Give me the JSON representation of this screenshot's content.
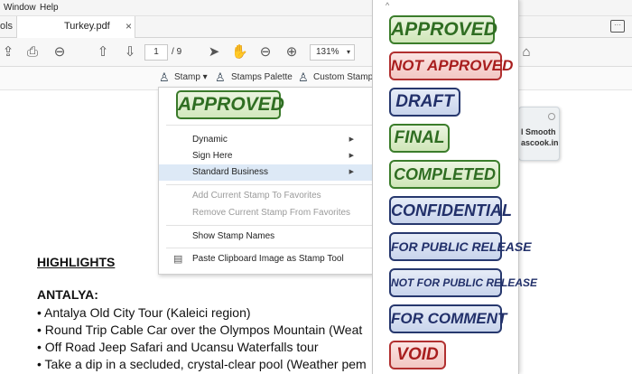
{
  "menubar": {
    "window": "Window",
    "help": "Help"
  },
  "tabs": {
    "tools": "ols",
    "document": "Turkey.pdf",
    "close": "×"
  },
  "toolbar": {
    "page_current": "1",
    "page_separator": "/",
    "page_total": "9",
    "zoom": "131%",
    "icons": [
      "upload-icon",
      "print-icon",
      "zoom-out-search-icon",
      "prev-page-icon",
      "next-page-icon",
      "select-arrow-icon",
      "hand-icon",
      "zoom-out-icon",
      "zoom-in-icon"
    ]
  },
  "stampbar": {
    "stamp": "Stamp",
    "palette": "Stamps Palette",
    "custom": "Custom Stamps"
  },
  "stamp_menu": {
    "preview": "APPROVED",
    "items": {
      "dynamic": "Dynamic",
      "sign_here": "Sign Here",
      "standard_business": "Standard Business",
      "add_favorites": "Add Current Stamp To Favorites",
      "remove_favorites": "Remove Current Stamp From Favorites",
      "show_names": "Show Stamp Names",
      "paste_clipboard": "Paste Clipboard Image as Stamp Tool"
    }
  },
  "palette": {
    "caret": "^",
    "stamps": [
      "APPROVED",
      "NOT APPROVED",
      "DRAFT",
      "FINAL",
      "COMPLETED",
      "CONFIDENTIAL",
      "FOR PUBLIC RELEASE",
      "NOT FOR PUBLIC RELEASE",
      "FOR COMMENT",
      "VOID"
    ],
    "colors": {
      "green": "#2f6d22",
      "red": "#a81e1e",
      "blue": "#22306a"
    }
  },
  "tag": {
    "line1": "l Smooth",
    "line2": "ascook.in"
  },
  "document": {
    "highlights": "HIGHLIGHTS",
    "city": "ANTALYA:",
    "bullets": [
      "• Antalya Old City Tour (Kaleici region)",
      "• Round Trip Cable Car over the Olympos Mountain (Weat",
      "• Off Road Jeep Safari and Ucansu Waterfalls tour",
      "• Take a dip in a secluded, crystal-clear pool (Weather pem"
    ]
  }
}
